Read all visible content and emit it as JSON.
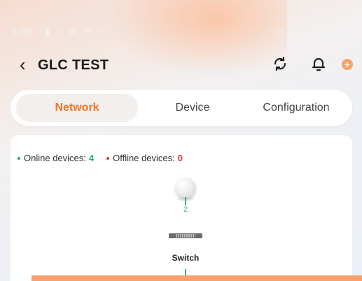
{
  "status_bar": {
    "time": "3:06",
    "battery": "14%"
  },
  "header": {
    "title": "GLC TEST"
  },
  "tabs": [
    {
      "label": "Network",
      "active": true
    },
    {
      "label": "Device",
      "active": false
    },
    {
      "label": "Configuration",
      "active": false
    }
  ],
  "legend": {
    "online_label": "Online devices:",
    "online_count": "4",
    "offline_label": "Offline devices:",
    "offline_count": "0"
  },
  "topology": {
    "router_link_count": "2",
    "switch_label": "Switch"
  },
  "colors": {
    "accent": "#f0742b",
    "online": "#22b573",
    "offline": "#e8332a"
  }
}
